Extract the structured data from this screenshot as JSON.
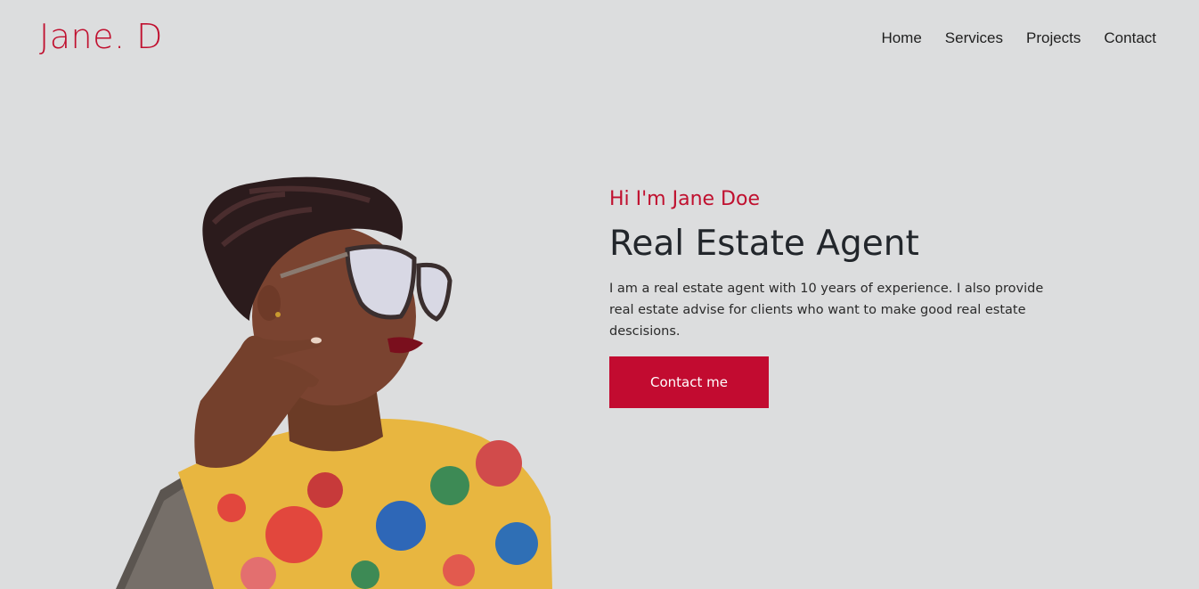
{
  "brand": {
    "logo_text": "Jane. D",
    "accent_color": "#c0102f"
  },
  "nav": {
    "items": [
      {
        "label": "Home"
      },
      {
        "label": "Services"
      },
      {
        "label": "Projects"
      },
      {
        "label": "Contact"
      }
    ]
  },
  "hero": {
    "greeting": "Hi I'm Jane Doe",
    "title": "Real Estate Agent",
    "description": "I am a real estate agent with 10 years of experience. I also provide real estate advise for clients who want to make good real estate descisions.",
    "cta_label": "Contact me",
    "cta_color": "#c20b30"
  },
  "colors": {
    "background": "#dcddde",
    "text_dark": "#22262b"
  }
}
